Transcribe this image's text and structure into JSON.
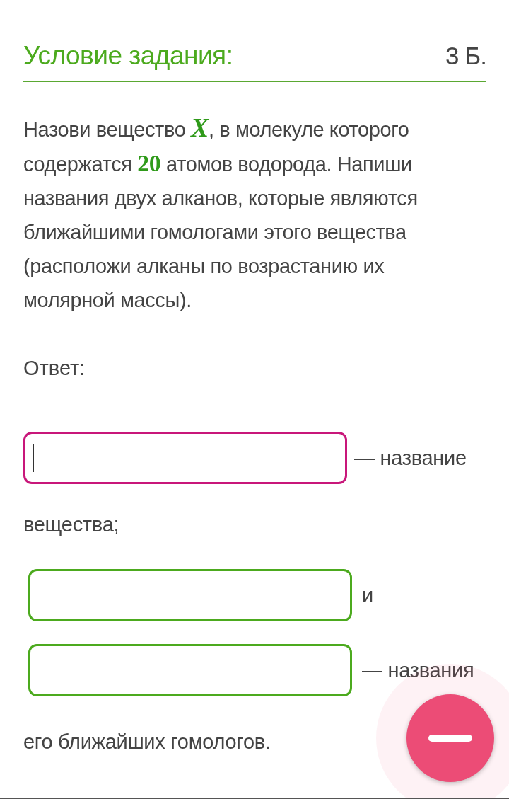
{
  "header": {
    "title": "Условие задания:",
    "points": "3 Б."
  },
  "question": "Назови вещество *X*, в молекуле которого содержатся **20** атомов водорода. Напиши названия двух алканов, которые являются ближайшими гомологами этого вещества (расположи алканы по возрастанию их молярной массы).",
  "answer_label": "Ответ:",
  "answer": [
    {
      "kind": "field",
      "focused": true
    },
    {
      "kind": "text",
      "text": "— название"
    },
    {
      "kind": "text",
      "text": "вещества;"
    },
    {
      "kind": "break"
    },
    {
      "kind": "field",
      "focused": false
    },
    {
      "kind": "text",
      "text": "и"
    },
    {
      "kind": "break"
    },
    {
      "kind": "field",
      "focused": false
    },
    {
      "kind": "text",
      "text": "— названия"
    },
    {
      "kind": "text",
      "text": "его ближайших гомологов."
    }
  ],
  "fab": {
    "kind": "minus"
  }
}
